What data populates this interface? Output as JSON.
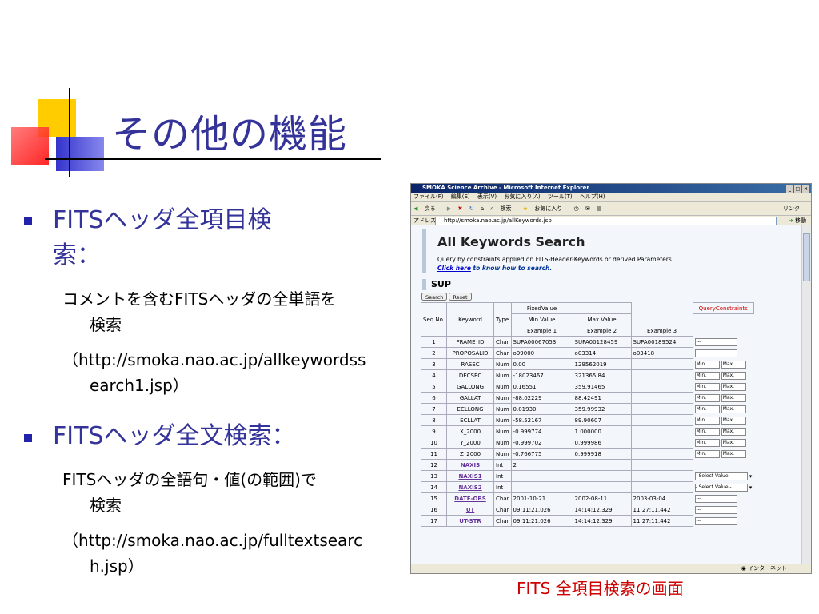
{
  "slide": {
    "title": "その他の機能",
    "bullets": [
      {
        "heading_line1": "FITSヘッダ全項目検",
        "heading_line2": "索：",
        "desc_line1": "コメントを含むFITSヘッダの全単語を",
        "desc_line2": "検索",
        "url_line1": "（http://smoka.nao.ac.jp/allkeywordss",
        "url_line2": "earch1.jsp）"
      },
      {
        "heading": "FITSヘッダ全文検索：",
        "desc_line1": "FITSヘッダの全語句・値(の範囲)で",
        "desc_line2": "検索",
        "url_line1": "（http://smoka.nao.ac.jp/fulltextsearc",
        "url_line2": "h.jsp）"
      }
    ],
    "caption": "FITS 全項目検索の画面"
  },
  "browser": {
    "window_title": "SMOKA Science Archive - Microsoft Internet Explorer",
    "menu": [
      "ファイル(F)",
      "編集(E)",
      "表示(V)",
      "お気に入り(A)",
      "ツール(T)",
      "ヘルプ(H)"
    ],
    "toolbar": [
      "戻る",
      "検索",
      "お気に入り"
    ],
    "toolbar_right": "リンク",
    "address_label": "アドレス(D)",
    "address": "http://smoka.nao.ac.jp/allKeywords.jsp",
    "go_label": "移動",
    "status_zone": "インターネット",
    "page": {
      "heading": "All Keywords Search",
      "desc": "Query by constraints applied on FITS-Header-Keywords or derived Parameters",
      "link_text": "Click here",
      "link_rest": " to know how to search.",
      "section": "SUP",
      "search_btn": "Search",
      "reset_btn": "Reset",
      "headers": {
        "seq": "Seq.No.",
        "keyword": "Keyword",
        "type": "Type",
        "fixed": "FixedValue",
        "query": "QueryConstraints",
        "min": "Min.Value",
        "max": "Max.Value",
        "ex1": "Example 1",
        "ex2": "Example 2",
        "ex3": "Example 3"
      },
      "min_ph": "Min.",
      "max_ph": "Max.",
      "fixed_ph": "---",
      "select_ph": "- Select Value -",
      "rows": [
        {
          "seq": "1",
          "kw": "FRAME_ID",
          "type": "Char",
          "ex1": "SUPA00067053",
          "ex2": "SUPA00128459",
          "ex3": "SUPA00189524",
          "q": "fixed"
        },
        {
          "seq": "2",
          "kw": "PROPOSALID",
          "type": "Char",
          "ex1": "o99000",
          "ex2": "o03314",
          "ex3": "o03418",
          "q": "fixed"
        },
        {
          "seq": "3",
          "kw": "RASEC",
          "type": "Num",
          "ex1": "0.00",
          "ex2": "129562019",
          "ex3": "",
          "q": "range"
        },
        {
          "seq": "4",
          "kw": "DECSEC",
          "type": "Num",
          "ex1": "-18023467",
          "ex2": "321365.84",
          "ex3": "",
          "q": "range"
        },
        {
          "seq": "5",
          "kw": "GALLONG",
          "type": "Num",
          "ex1": "0.16551",
          "ex2": "359.91465",
          "ex3": "",
          "q": "range"
        },
        {
          "seq": "6",
          "kw": "GALLAT",
          "type": "Num",
          "ex1": "-88.02229",
          "ex2": "88.42491",
          "ex3": "",
          "q": "range"
        },
        {
          "seq": "7",
          "kw": "ECLLONG",
          "type": "Num",
          "ex1": "0.01930",
          "ex2": "359.99932",
          "ex3": "",
          "q": "range"
        },
        {
          "seq": "8",
          "kw": "ECLLAT",
          "type": "Num",
          "ex1": "-58.52167",
          "ex2": "89.90607",
          "ex3": "",
          "q": "range"
        },
        {
          "seq": "9",
          "kw": "X_2000",
          "type": "Num",
          "ex1": "-0.999774",
          "ex2": "1.000000",
          "ex3": "",
          "q": "range"
        },
        {
          "seq": "10",
          "kw": "Y_2000",
          "type": "Num",
          "ex1": "-0.999702",
          "ex2": "0.999986",
          "ex3": "",
          "q": "range"
        },
        {
          "seq": "11",
          "kw": "Z_2000",
          "type": "Num",
          "ex1": "-0.766775",
          "ex2": "0.999918",
          "ex3": "",
          "q": "range"
        },
        {
          "seq": "12",
          "kw": "NAXIS",
          "type": "Int",
          "ex1": "2",
          "ex2": "",
          "ex3": "",
          "q": "none",
          "link": true
        },
        {
          "seq": "13",
          "kw": "NAXIS1",
          "type": "Int",
          "ex1": "",
          "ex2": "",
          "ex3": "",
          "q": "select",
          "link": true
        },
        {
          "seq": "14",
          "kw": "NAXIS2",
          "type": "Int",
          "ex1": "",
          "ex2": "",
          "ex3": "",
          "q": "select",
          "link": true
        },
        {
          "seq": "15",
          "kw": "DATE-OBS",
          "type": "Char",
          "ex1": "2001-10-21",
          "ex2": "2002-08-11",
          "ex3": "2003-03-04",
          "q": "fixed",
          "link": true
        },
        {
          "seq": "16",
          "kw": "UT",
          "type": "Char",
          "ex1": "09:11:21.026",
          "ex2": "14:14:12.329",
          "ex3": "11:27:11.442",
          "q": "fixed",
          "link": true
        },
        {
          "seq": "17",
          "kw": "UT-STR",
          "type": "Char",
          "ex1": "09:11:21.026",
          "ex2": "14:14:12.329",
          "ex3": "11:27:11.442",
          "q": "fixed",
          "link": true
        }
      ]
    }
  }
}
